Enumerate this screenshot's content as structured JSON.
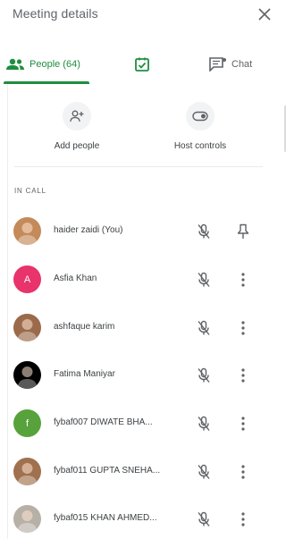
{
  "header": {
    "title": "Meeting details"
  },
  "tabs": {
    "people": "People (64)",
    "chat": "Chat"
  },
  "actions": {
    "add_people": "Add people",
    "host_controls": "Host controls"
  },
  "section_label": "IN CALL",
  "participants": [
    {
      "name": "haider zaidi (You)",
      "avatar_text": "",
      "avatar_color": "#c48a5a",
      "action_icon": "pin-icon"
    },
    {
      "name": "Asfia Khan",
      "avatar_text": "A",
      "avatar_color": "#e8336b",
      "action_icon": "more-vert-icon"
    },
    {
      "name": "ashfaque karim",
      "avatar_text": "",
      "avatar_color": "#9a6a4a",
      "action_icon": "more-vert-icon"
    },
    {
      "name": "Fatima Maniyar",
      "avatar_text": "",
      "avatar_color": "#000000",
      "action_icon": "more-vert-icon"
    },
    {
      "name": "fybaf007 DIWATE BHA...",
      "avatar_text": "f",
      "avatar_color": "#58a23b",
      "action_icon": "more-vert-icon"
    },
    {
      "name": "fybaf011 GUPTA SNEHA...",
      "avatar_text": "",
      "avatar_color": "#a0714e",
      "action_icon": "more-vert-icon"
    },
    {
      "name": "fybaf015 KHAN AHMED...",
      "avatar_text": "",
      "avatar_color": "#b7b0a6",
      "action_icon": "more-vert-icon"
    }
  ],
  "colors": {
    "accent": "#1e8e3e",
    "text": "#3c4043",
    "muted": "#5f6368"
  }
}
